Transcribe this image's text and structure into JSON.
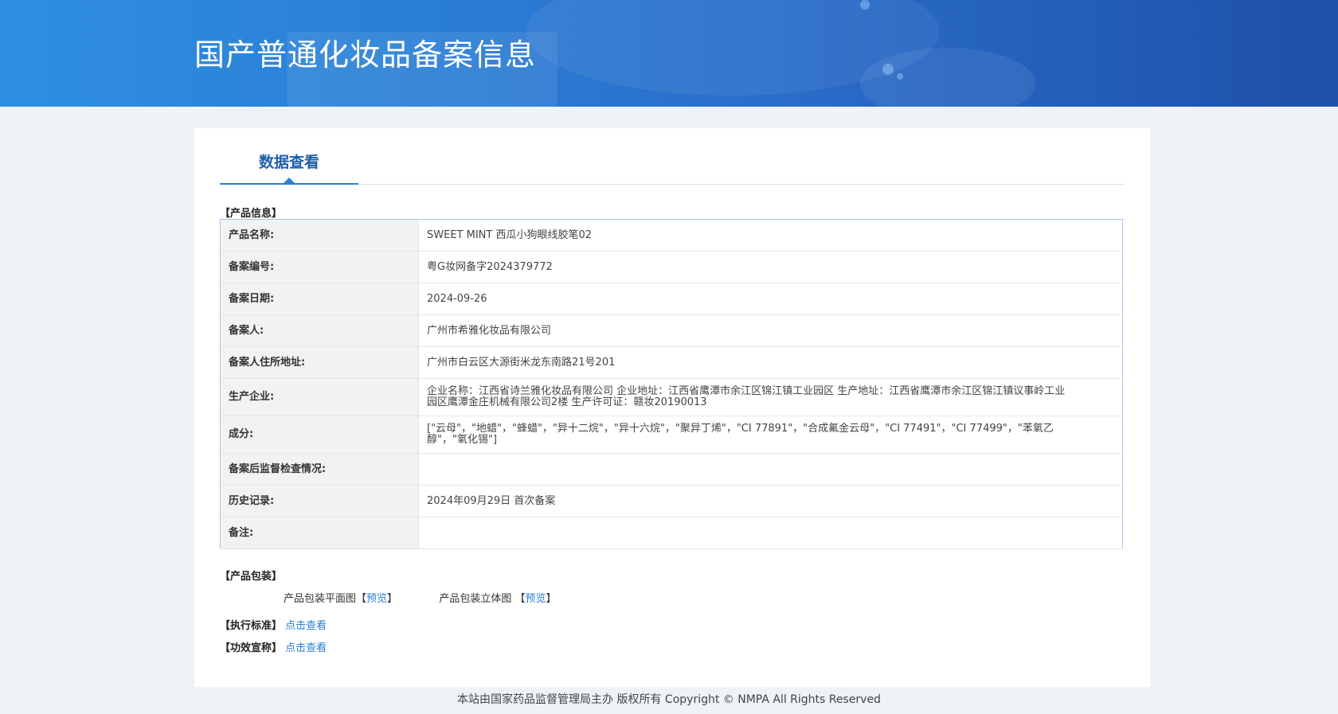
{
  "header": {
    "title": "国产普通化妆品备案信息"
  },
  "tabs": [
    {
      "label": "数据查看"
    }
  ],
  "sections": {
    "product_info": "【产品信息】",
    "packaging": "【产品包装】",
    "standard": "【执行标准】",
    "efficacy": "【功效宣称】"
  },
  "product_info": [
    {
      "label": "产品名称:",
      "value": "SWEET MINT 西瓜小狗眼线胶笔02"
    },
    {
      "label": "备案编号:",
      "value": "粤G妆网备字2024379772"
    },
    {
      "label": "备案日期:",
      "value": "2024-09-26"
    },
    {
      "label": "备案人:",
      "value": "广州市希雅化妆品有限公司"
    },
    {
      "label": "备案人住所地址:",
      "value": "广州市白云区大源街米龙东南路21号201"
    },
    {
      "label": "生产企业:",
      "value": "企业名称：江西省诗兰雅化妆品有限公司 企业地址：江西省鹰潭市余江区锦江镇工业园区 生产地址：江西省鹰潭市余江区锦江镇议事岭工业园区鹰潭金庄机械有限公司2楼 生产许可证：赣妆20190013"
    },
    {
      "label": "成分:",
      "value": "[\"云母\"，\"地蜡\"，\"蜂蜡\"，\"异十二烷\"，\"异十六烷\"，\"聚异丁烯\"，\"CI 77891\"，\"合成氟金云母\"，\"CI 77491\"，\"CI 77499\"，\"苯氧乙醇\"，\"氧化锡\"]"
    },
    {
      "label": "备案后监督检查情况:",
      "value": ""
    },
    {
      "label": "历史记录:",
      "value": "2024年09月29日 首次备案"
    },
    {
      "label": "备注:",
      "value": ""
    }
  ],
  "packaging": {
    "flat_label": "产品包装平面图",
    "flat_link": "预览",
    "solid_label": "产品包装立体图",
    "solid_link": "预览",
    "bracket_open": "【",
    "bracket_close": "】"
  },
  "standard_link": "点击查看",
  "efficacy_link": "点击查看",
  "footer": "本站由国家药品监督管理局主办 版权所有 Copyright © NMPA All Rights Reserved",
  "colors": {
    "header_gradient_start": "#2f8fe0",
    "header_gradient_end": "#1f4fa8",
    "accent": "#2a7fd6",
    "background": "#eef3f7"
  }
}
